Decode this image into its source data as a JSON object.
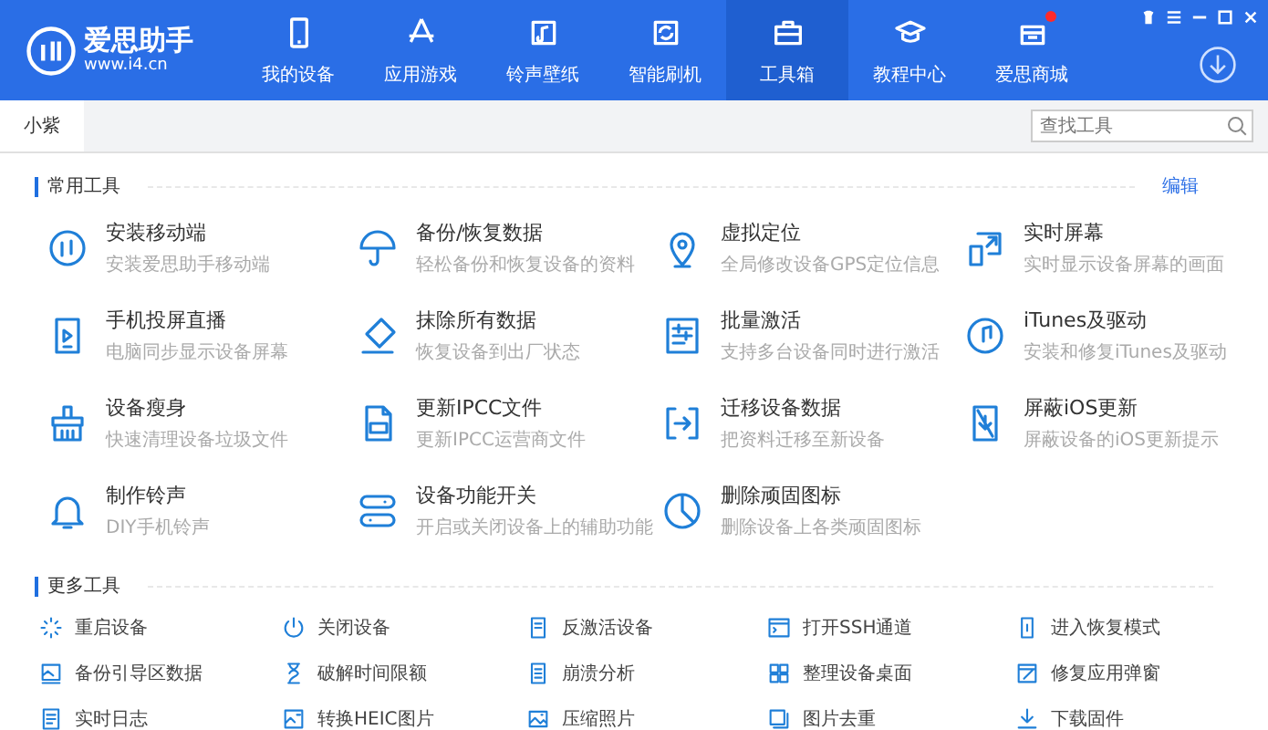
{
  "app": {
    "name": "爱思助手",
    "url": "www.i4.cn"
  },
  "nav": [
    {
      "label": "我的设备",
      "selected": false,
      "badge": false
    },
    {
      "label": "应用游戏",
      "selected": false,
      "badge": false
    },
    {
      "label": "铃声壁纸",
      "selected": false,
      "badge": false
    },
    {
      "label": "智能刷机",
      "selected": false,
      "badge": false
    },
    {
      "label": "工具箱",
      "selected": true,
      "badge": false
    },
    {
      "label": "教程中心",
      "selected": false,
      "badge": false
    },
    {
      "label": "爱思商城",
      "selected": false,
      "badge": true
    }
  ],
  "tabs": [
    {
      "label": "小紫",
      "selected": true
    }
  ],
  "search": {
    "placeholder": "查找工具"
  },
  "common_tools": {
    "title": "常用工具",
    "edit": "编辑",
    "items": [
      {
        "title": "安装移动端",
        "desc": "安装爱思助手移动端"
      },
      {
        "title": "备份/恢复数据",
        "desc": "轻松备份和恢复设备的资料"
      },
      {
        "title": "虚拟定位",
        "desc": "全局修改设备GPS定位信息"
      },
      {
        "title": "实时屏幕",
        "desc": "实时显示设备屏幕的画面"
      },
      {
        "title": "手机投屏直播",
        "desc": "电脑同步显示设备屏幕"
      },
      {
        "title": "抹除所有数据",
        "desc": "恢复设备到出厂状态"
      },
      {
        "title": "批量激活",
        "desc": "支持多台设备同时进行激活"
      },
      {
        "title": "iTunes及驱动",
        "desc": "安装和修复iTunes及驱动"
      },
      {
        "title": "设备瘦身",
        "desc": "快速清理设备垃圾文件"
      },
      {
        "title": "更新IPCC文件",
        "desc": "更新IPCC运营商文件"
      },
      {
        "title": "迁移设备数据",
        "desc": "把资料迁移至新设备"
      },
      {
        "title": "屏蔽iOS更新",
        "desc": "屏蔽设备的iOS更新提示"
      },
      {
        "title": "制作铃声",
        "desc": "DIY手机铃声"
      },
      {
        "title": "设备功能开关",
        "desc": "开启或关闭设备上的辅助功能"
      },
      {
        "title": "删除顽固图标",
        "desc": "删除设备上各类顽固图标"
      }
    ]
  },
  "more_tools": {
    "title": "更多工具",
    "items": [
      "重启设备",
      "关闭设备",
      "反激活设备",
      "打开SSH通道",
      "进入恢复模式",
      "备份引导区数据",
      "破解时间限额",
      "崩溃分析",
      "整理设备桌面",
      "修复应用弹窗",
      "实时日志",
      "转换HEIC图片",
      "压缩照片",
      "图片去重",
      "下载固件"
    ]
  }
}
